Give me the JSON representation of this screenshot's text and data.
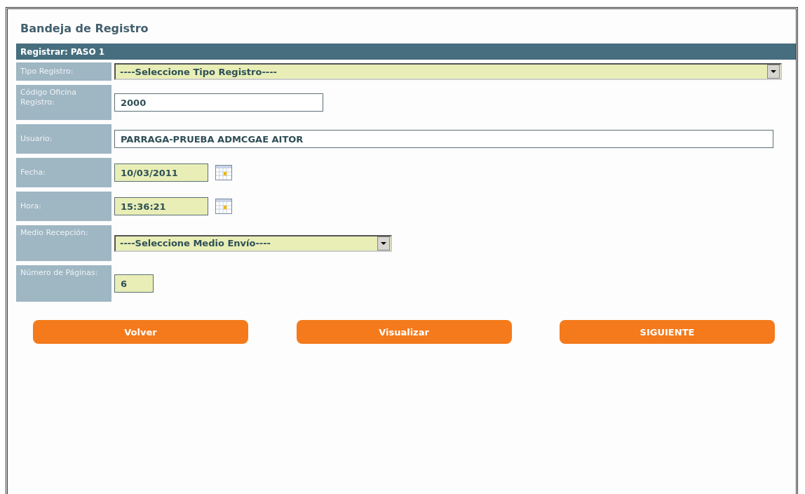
{
  "title": "Bandeja de Registro",
  "section": {
    "title": "Registrar: PASO 1"
  },
  "fields": [
    {
      "label": "Tipo Registro:",
      "kind": "select",
      "value": "----Seleccione Tipo Registro----",
      "highlighted": true
    },
    {
      "label": "Código Oficina Registro:",
      "kind": "text",
      "value": "2000",
      "highlighted": false
    },
    {
      "label": "Usuario:",
      "kind": "text",
      "value": "PARRAGA-PRUEBA ADMCGAE AITOR",
      "highlighted": false
    },
    {
      "label": "Fecha:",
      "kind": "date",
      "value": "10/03/2011",
      "highlighted": true
    },
    {
      "label": "Hora:",
      "kind": "date",
      "value": "15:36:21",
      "highlighted": true
    },
    {
      "label": "Medio Recepción:",
      "kind": "select",
      "value": "----Seleccione Medio Envío----",
      "highlighted": true
    },
    {
      "label": "Número de Páginas:",
      "kind": "text",
      "value": "6",
      "highlighted": true
    }
  ],
  "buttons": [
    "Volver",
    "Visualizar",
    "SIGUIENTE"
  ]
}
